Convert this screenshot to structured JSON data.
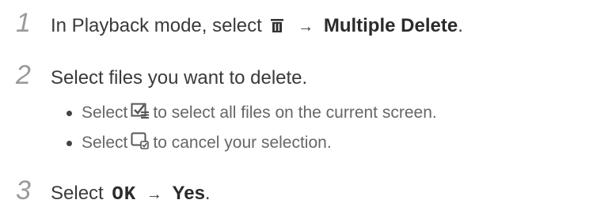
{
  "steps": [
    {
      "number": "1",
      "prefix": "In Playback mode, select",
      "arrow": "→",
      "bold_label": "Multiple Delete",
      "suffix": ".",
      "icon": "trash-icon"
    },
    {
      "number": "2",
      "text": "Select files you want to delete.",
      "bullets": [
        {
          "prefix": "Select",
          "icon": "select-all-icon",
          "suffix": "to select all files on the current screen."
        },
        {
          "prefix": "Select",
          "icon": "cancel-selection-icon",
          "suffix": "to cancel your selection."
        }
      ]
    },
    {
      "number": "3",
      "prefix": "Select",
      "ok_label": "OK",
      "arrow": "→",
      "bold_label": "Yes",
      "suffix": "."
    }
  ],
  "colors": {
    "step_number": "#9a9a9a",
    "text": "#3a3a3a",
    "bullet_text": "#666666"
  }
}
